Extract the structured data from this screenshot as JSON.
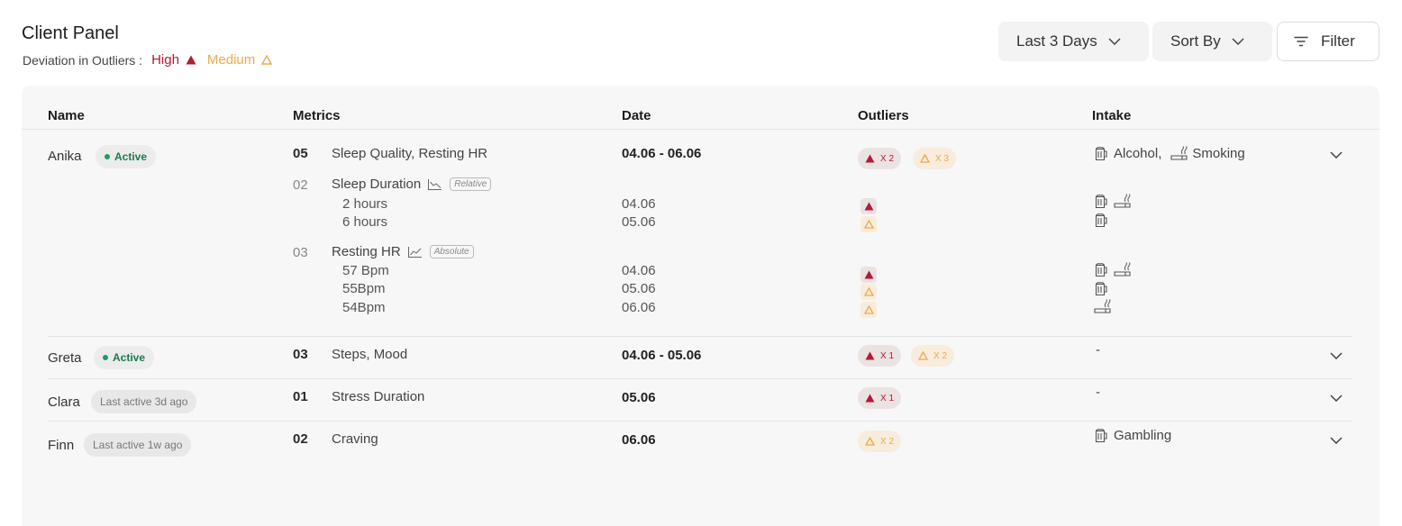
{
  "header": {
    "title": "Client Panel",
    "legend_label": "Deviation in Outliers :",
    "high_label": "High",
    "medium_label": "Medium"
  },
  "toolbar": {
    "range_label": "Last 3 Days",
    "sort_label": "Sort By",
    "filter_label": "Filter"
  },
  "colors": {
    "high": "#b21a37",
    "medium": "#f0a84a",
    "active": "#1f9b64"
  },
  "table": {
    "columns": [
      "Name",
      "Metrics",
      "Date",
      "Outliers",
      "Intake"
    ],
    "rows": [
      {
        "name": "Anika",
        "status": "Active",
        "count": "05",
        "metrics": "Sleep Quality, Resting HR",
        "date": "04.06 - 06.06",
        "outliers": {
          "high": "X 2",
          "medium": "X 3"
        },
        "intake": {
          "first": "Alcohol,",
          "second": "Smoking"
        },
        "details": [
          {
            "count": "02",
            "metric": "Sleep Duration",
            "trend_icon": "trend-down-icon",
            "tag": "Relative",
            "values": [
              {
                "value": "2 hours",
                "date": "04.06",
                "level": "high",
                "intake_icons": [
                  "beer-icon",
                  "cigarette-icon"
                ]
              },
              {
                "value": "6 hours",
                "date": "05.06",
                "level": "medium",
                "intake_icons": [
                  "beer-icon"
                ]
              }
            ]
          },
          {
            "count": "03",
            "metric": "Resting HR",
            "trend_icon": "trend-up-icon",
            "tag": "Absolute",
            "values": [
              {
                "value": "57 Bpm",
                "date": "04.06",
                "level": "high",
                "intake_icons": [
                  "beer-icon",
                  "cigarette-icon"
                ]
              },
              {
                "value": "55Bpm",
                "date": "05.06",
                "level": "medium",
                "intake_icons": [
                  "beer-icon"
                ]
              },
              {
                "value": "54Bpm",
                "date": "06.06",
                "level": "medium",
                "intake_icons": [
                  "cigarette-icon"
                ]
              }
            ]
          }
        ]
      },
      {
        "name": "Greta",
        "status": "Active",
        "count": "03",
        "metrics": "Steps, Mood",
        "date": "04.06 - 05.06",
        "outliers": {
          "high": "X 1",
          "medium": "X 2"
        },
        "intake": "-"
      },
      {
        "name": "Clara",
        "status": "Last active 3d ago",
        "count": "01",
        "metrics": "Stress Duration",
        "date": "05.06",
        "outliers": {
          "high": "X 1"
        },
        "intake": "-"
      },
      {
        "name": "Finn",
        "status": "Last active 1w ago",
        "count": "02",
        "metrics": "Craving",
        "date": "06.06",
        "outliers": {
          "medium": "X 2"
        },
        "intake": "Gambling"
      }
    ]
  }
}
